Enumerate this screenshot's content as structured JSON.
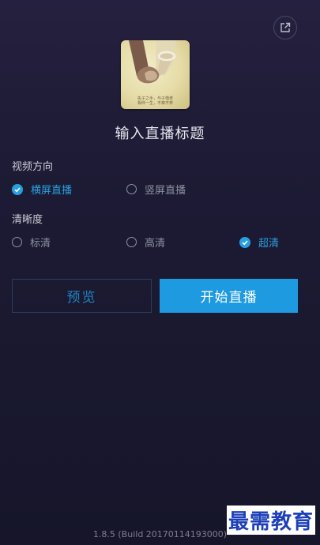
{
  "header": {
    "share_icon": "external-link-icon"
  },
  "cover": {
    "caption_line1": "执子之手，与子偕老",
    "caption_line2": "相伴一生，不离不弃"
  },
  "title": "输入直播标题",
  "orientation": {
    "label": "视频方向",
    "options": [
      {
        "label": "横屏直播",
        "checked": true
      },
      {
        "label": "竖屏直播",
        "checked": false
      }
    ]
  },
  "quality": {
    "label": "清晰度",
    "options": [
      {
        "label": "标清",
        "checked": false
      },
      {
        "label": "高清",
        "checked": false
      },
      {
        "label": "超清",
        "checked": true
      }
    ]
  },
  "buttons": {
    "preview": "预览",
    "start": "开始直播"
  },
  "colors": {
    "accent": "#1e9ae0",
    "background": "#1d1b35"
  },
  "version": "1.8.5 (Build 20170114193000)",
  "watermark": "最需教育"
}
